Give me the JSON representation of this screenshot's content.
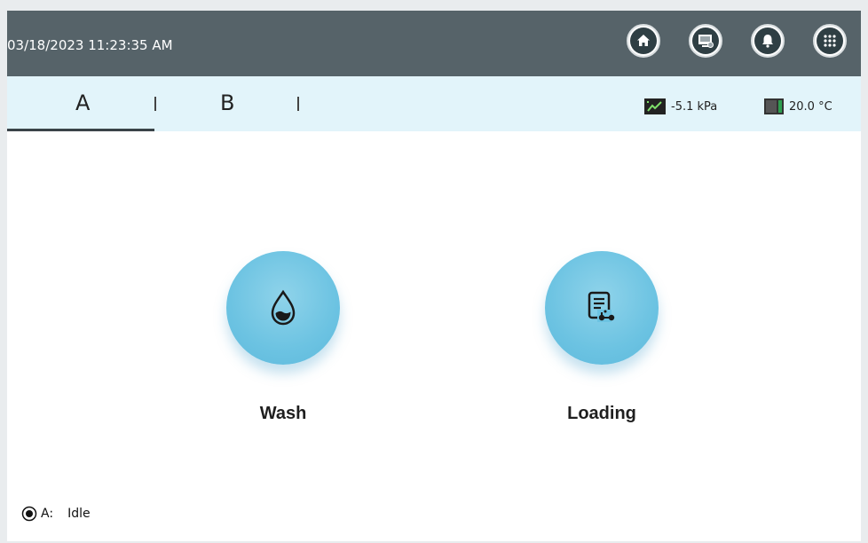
{
  "header": {
    "datetime": "03/18/2023 11:23:35 AM",
    "buttons": [
      {
        "name": "home-button",
        "icon": "home-icon"
      },
      {
        "name": "log-button",
        "icon": "document-screen-icon"
      },
      {
        "name": "alarm-button",
        "icon": "bell-icon"
      },
      {
        "name": "menu-button",
        "icon": "grid-icon"
      }
    ]
  },
  "tabs": {
    "a_label": "A",
    "b_label": "B",
    "active": "A"
  },
  "sensors": {
    "pressure": "-5.1 kPa",
    "temperature": "20.0 °C"
  },
  "actions": {
    "wash_label": "Wash",
    "loading_label": "Loading"
  },
  "status": {
    "channel": "A:",
    "state": "Idle"
  },
  "colors": {
    "topbar": "#566369",
    "tabbar": "#e2f4fa",
    "accent_circle": "#6cc3e2"
  }
}
